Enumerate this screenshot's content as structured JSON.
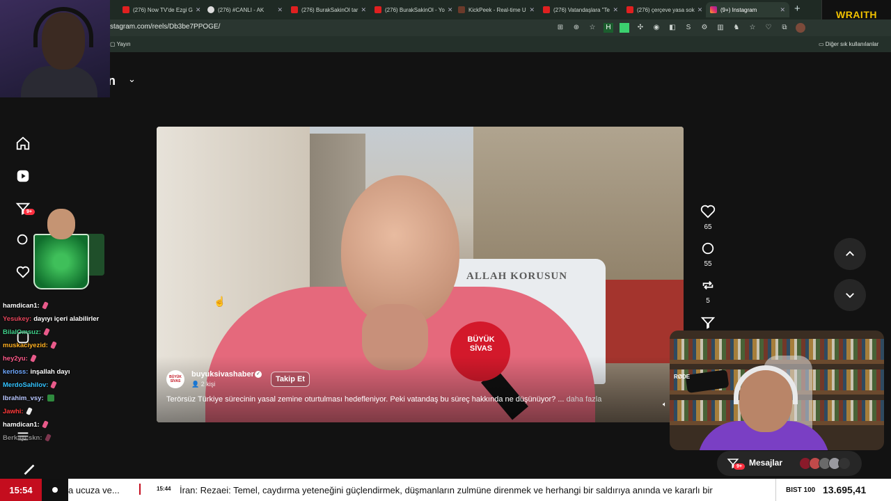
{
  "browser": {
    "tabs": [
      {
        "title": "(276) Now TV'de Ezgi G"
      },
      {
        "title": "(276) #CANLI - AK"
      },
      {
        "title": "(276) BurakSakinOl tar"
      },
      {
        "title": "(276) BurakSakinOl - Yo"
      },
      {
        "title": "KickPeek - Real-time U"
      },
      {
        "title": "(276) Vatandaşlara \"Te"
      },
      {
        "title": "(276) çerçeve yasa sok"
      },
      {
        "title": "(9+) Instagram"
      }
    ],
    "url": "stagram.com/reels/Db3be7PPOGE/",
    "bookmarks": {
      "left": "Yayın",
      "right": "Diğer sık kullanılanlar"
    },
    "extension_brand": "WRAITH"
  },
  "instagram": {
    "header_title": "in",
    "nav_badge": "9+",
    "post": {
      "account": "buyuksivashaber",
      "account_logo": "BÜYÜK SİVAS",
      "followers": "2 kişi",
      "follow_label": "Takip Et",
      "caption": "Terörsüz Türkiye sürecinin yasal zemine oturtulması hedefleniyor. Peki vatandaş bu süreç hakkında ne düşünüyor? ...",
      "more_label": "daha fazla",
      "van_text": "ALLAH KORUSUN",
      "mic_label": "BÜYÜK SİVAS"
    },
    "actions": {
      "likes": "65",
      "comments": "55",
      "reposts": "5"
    },
    "messages": {
      "label": "Mesajlar",
      "badge": "9+"
    }
  },
  "chat": [
    {
      "user": "hamdican1:",
      "message": "",
      "color": "#ffffff"
    },
    {
      "user": "Yesukey:",
      "message": "dayıyı içeri alabilirler",
      "color": "#e4455b"
    },
    {
      "user": "BilalOmsuz:",
      "message": "",
      "color": "#3fd18a"
    },
    {
      "user": "muskaciyezid:",
      "message": "",
      "color": "#ffb020"
    },
    {
      "user": "hey2yu:",
      "message": "",
      "color": "#ff5a8a"
    },
    {
      "user": "kerloss:",
      "message": "inşallah dayı",
      "color": "#6fa8ff"
    },
    {
      "user": "MerdoSahilov:",
      "message": "",
      "color": "#33c3ff"
    },
    {
      "user": "Ibrahim_vsy:",
      "message": "",
      "color": "#b9c7ff"
    },
    {
      "user": "Jawhi:",
      "message": "",
      "color": "#ff3a3a"
    },
    {
      "user": "hamdican1:",
      "message": "",
      "color": "#ffffff"
    },
    {
      "user": "Berkaycskn:",
      "message": "",
      "color": "#8a8a8a"
    }
  ],
  "ticker": {
    "time": "15:54",
    "text1": "a ucuza ve...",
    "time2": "15:44",
    "text2": "İran: Rezaei: Temel, caydırma yeteneğini güçlendirmek, düşmanların zulmüne direnmek ve herhangi bir saldırıya anında ve kararlı bir",
    "index_label": "BIST 100",
    "index_value": "13.695,41"
  },
  "webcam2": {
    "mic_brand": "RØDE"
  },
  "colors": {
    "accent": "#ff3040",
    "ticker_red": "#c40d1e",
    "brand_yellow": "#f2c200"
  }
}
